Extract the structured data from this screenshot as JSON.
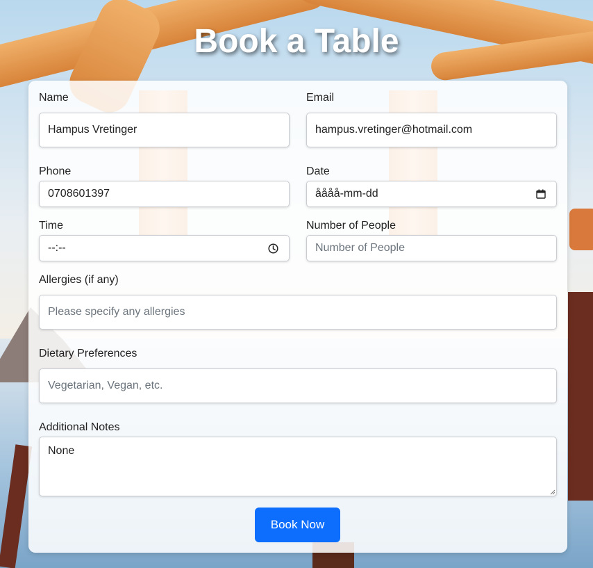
{
  "title": "Book a Table",
  "form": {
    "name": {
      "label": "Name",
      "value": "Hampus Vretinger"
    },
    "email": {
      "label": "Email",
      "value": "hampus.vretinger@hotmail.com"
    },
    "phone": {
      "label": "Phone",
      "value": "0708601397"
    },
    "date": {
      "label": "Date",
      "value": "åååå-mm-dd",
      "icon": "calendar-icon"
    },
    "time": {
      "label": "Time",
      "value": "--:--",
      "icon": "clock-icon"
    },
    "people": {
      "label": "Number of People",
      "placeholder": "Number of People"
    },
    "allergies": {
      "label": "Allergies (if any)",
      "placeholder": "Please specify any allergies"
    },
    "dietary": {
      "label": "Dietary Preferences",
      "placeholder": "Vegetarian, Vegan, etc."
    },
    "notes": {
      "label": "Additional Notes",
      "value": "None"
    },
    "submit_label": "Book Now"
  },
  "colors": {
    "button": "#0d6efd",
    "title": "#ffffff"
  }
}
